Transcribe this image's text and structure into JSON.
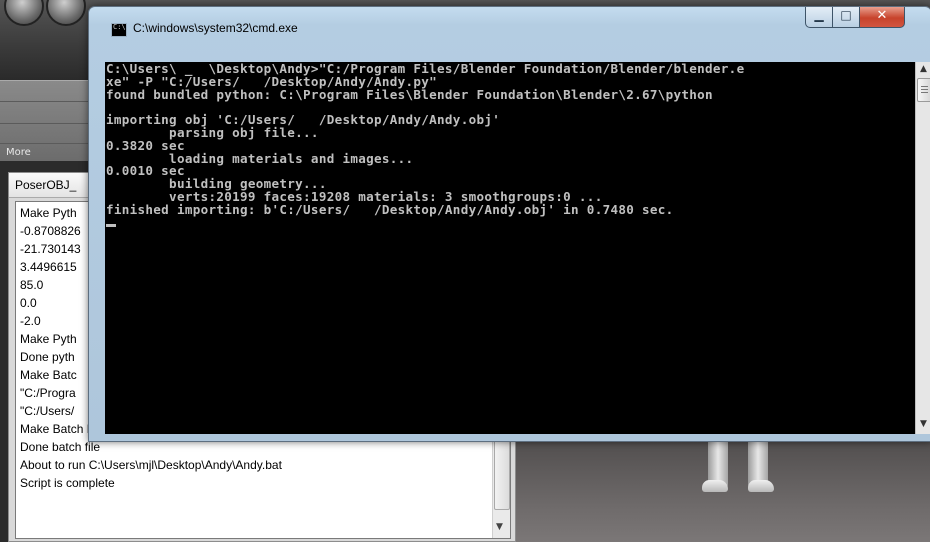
{
  "background_app": {
    "more_label": "More",
    "panel_title": "PoserOBJ_",
    "log_lines": [
      "Make Pyth",
      "-0.8708826",
      "-21.730143",
      "3.4496615",
      "85.0",
      "0.0",
      "-2.0",
      "Make Pyth",
      "Done pyth",
      "Make Batc",
      "\"C:/Progra",
      "\"C:/Users/",
      "Make Batch File completed.",
      "Done batch file",
      "About to run C:\\Users\\mjl\\Desktop\\Andy\\Andy.bat",
      "Script is complete"
    ]
  },
  "cmd_window": {
    "title": "C:\\windows\\system32\\cmd.exe",
    "app_icon": "cmd-icon",
    "controls": {
      "minimize": "minimize-icon",
      "maximize": "maximize-icon",
      "close": "close-icon"
    },
    "console_output": "C:\\Users\\ _  \\Desktop\\Andy>\"C:/Program Files/Blender Foundation/Blender/blender.e\nxe\" -P \"C:/Users/   /Desktop/Andy/Andy.py\"\nfound bundled python: C:\\Program Files\\Blender Foundation\\Blender\\2.67\\python\n\nimporting obj 'C:/Users/   /Desktop/Andy/Andy.obj'\n        parsing obj file...\n0.3820 sec\n        loading materials and images...\n0.0010 sec\n        building geometry...\n        verts:20199 faces:19208 materials: 3 smoothgroups:0 ...\nfinished importing: b'C:/Users/   /Desktop/Andy/Andy.obj' in 0.7480 sec.\n",
    "colors": {
      "console_bg": "#000000",
      "console_fg": "#c0c0c0",
      "close_button": "#c7432c"
    }
  }
}
